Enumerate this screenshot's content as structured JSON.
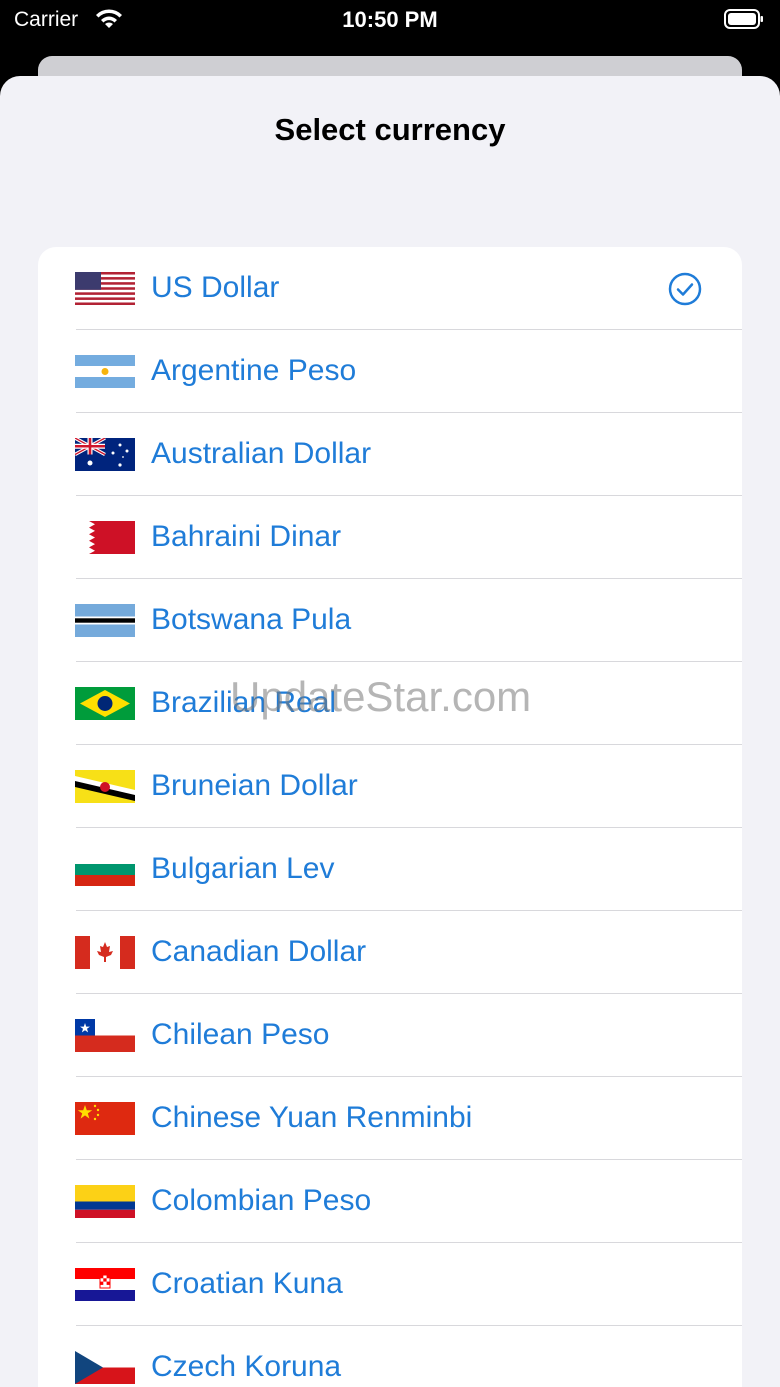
{
  "status_bar": {
    "carrier": "Carrier",
    "time": "10:50 PM"
  },
  "sheet": {
    "title": "Select currency"
  },
  "currencies": [
    {
      "name": "US Dollar",
      "selected": true,
      "flag": "us-flag"
    },
    {
      "name": "Argentine Peso",
      "flag": "ar-flag"
    },
    {
      "name": "Australian Dollar",
      "flag": "au-flag"
    },
    {
      "name": "Bahraini Dinar",
      "flag": "bh-flag"
    },
    {
      "name": "Botswana Pula",
      "flag": "bw-flag"
    },
    {
      "name": "Brazilian Real",
      "flag": "br-flag"
    },
    {
      "name": "Bruneian Dollar",
      "flag": "bn-flag"
    },
    {
      "name": "Bulgarian Lev",
      "flag": "bg-flag"
    },
    {
      "name": "Canadian Dollar",
      "flag": "ca-flag"
    },
    {
      "name": "Chilean Peso",
      "flag": "cl-flag"
    },
    {
      "name": "Chinese Yuan Renminbi",
      "flag": "cn-flag"
    },
    {
      "name": "Colombian Peso",
      "flag": "co-flag"
    },
    {
      "name": "Croatian Kuna",
      "flag": "hr-flag"
    },
    {
      "name": "Czech Koruna",
      "flag": "cz-flag"
    }
  ],
  "watermark": "UpdateStar.com",
  "colors": {
    "accent": "#1f7cd8",
    "background": "#f2f2f7",
    "separator": "#d8d8dc"
  }
}
